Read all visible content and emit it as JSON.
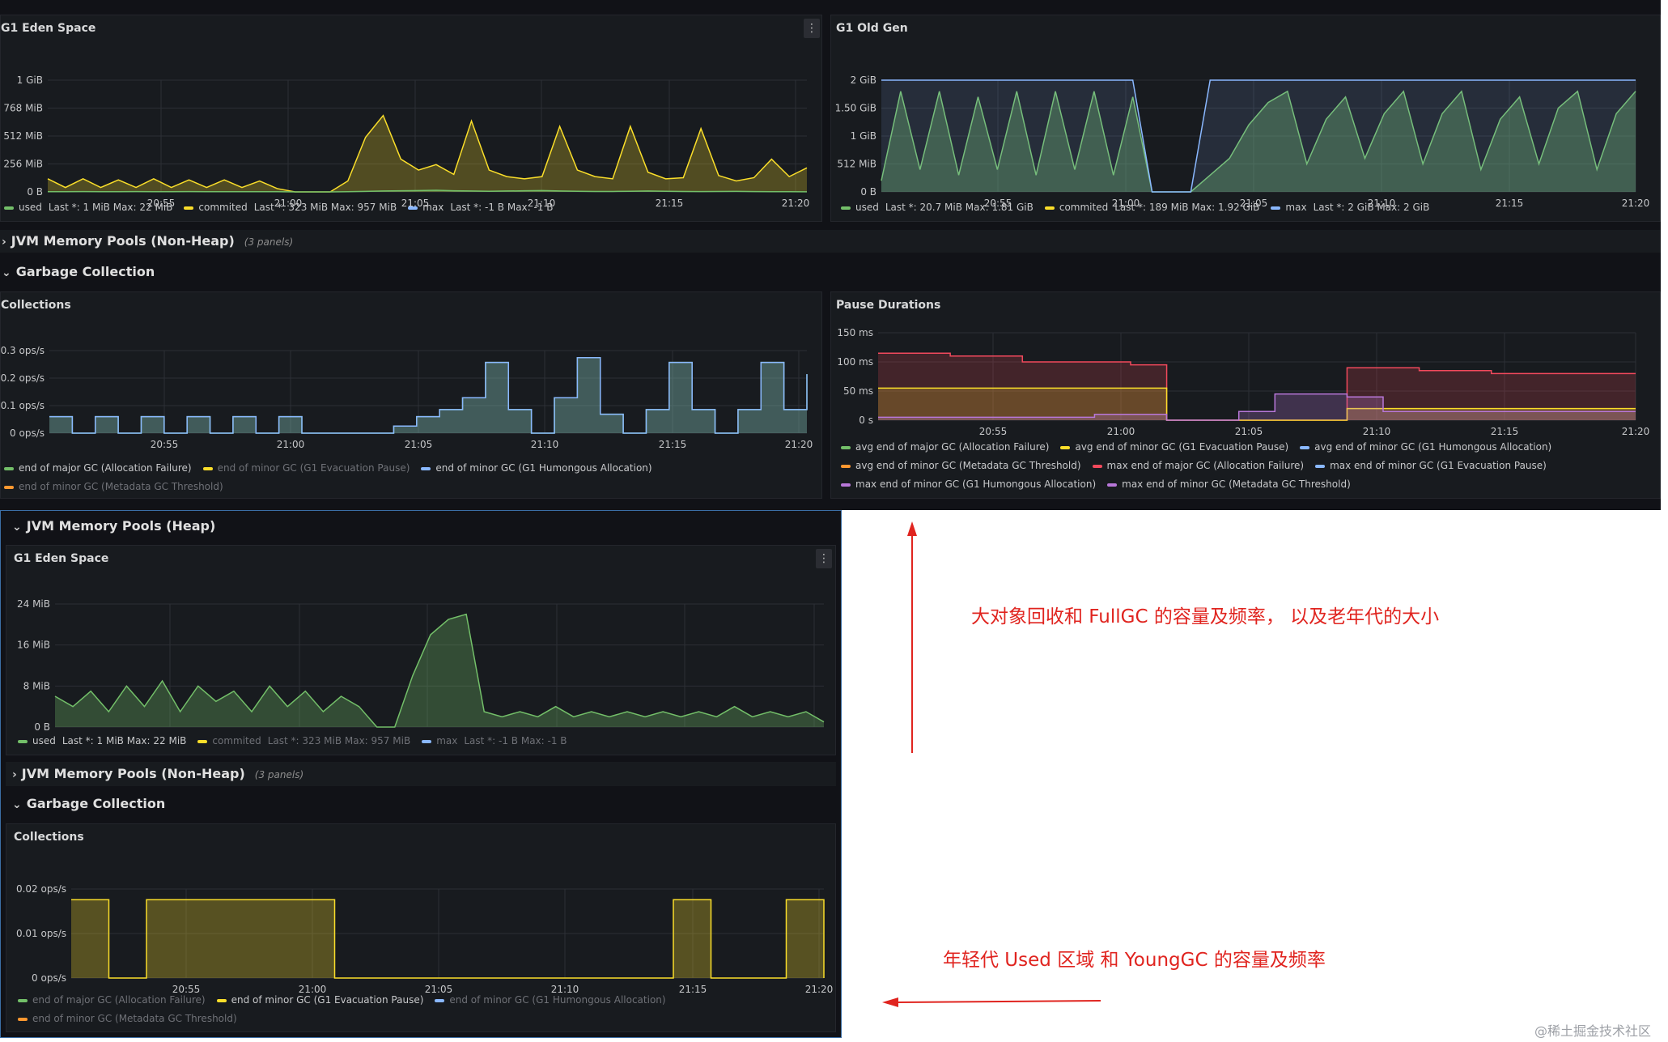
{
  "rows": {
    "non_heap": "JVM Memory Pools (Non-Heap)",
    "non_heap_count": "(3 panels)",
    "gc": "Garbage Collection",
    "heap": "JVM Memory Pools (Heap)"
  },
  "colors": {
    "green": "#73bf69",
    "yellow": "#fade2a",
    "blue": "#8ab8ff",
    "orange": "#ff9830",
    "red": "#f2495c",
    "purple": "#b877d9",
    "annotation": "#e0241f"
  },
  "panels": {
    "eden_top": {
      "title": "G1 Eden Space",
      "y_ticks": [
        "1 GiB",
        "768 MiB",
        "512 MiB",
        "256 MiB",
        "0 B"
      ],
      "x_ticks": [
        "20:55",
        "21:00",
        "21:05",
        "21:10",
        "21:15",
        "21:20"
      ],
      "legend": [
        {
          "name": "used",
          "stats": "Last *: 1 MiB  Max: 22 MiB",
          "color": "green"
        },
        {
          "name": "commited",
          "stats": "Last *: 323 MiB  Max: 957 MiB",
          "color": "yellow"
        },
        {
          "name": "max",
          "stats": "Last *: -1 B  Max: -1 B",
          "color": "blue"
        }
      ]
    },
    "old_gen": {
      "title": "G1 Old Gen",
      "y_ticks": [
        "2 GiB",
        "1.50 GiB",
        "1 GiB",
        "512 MiB",
        "0 B"
      ],
      "x_ticks": [
        "20:55",
        "21:00",
        "21:05",
        "21:10",
        "21:15",
        "21:20"
      ],
      "legend": [
        {
          "name": "used",
          "stats": "Last *: 20.7 MiB  Max: 1.81 GiB",
          "color": "green"
        },
        {
          "name": "commited",
          "stats": "Last *: 189 MiB  Max: 1.92 GiB",
          "color": "yellow"
        },
        {
          "name": "max",
          "stats": "Last *: 2 GiB  Max: 2 GiB",
          "color": "blue"
        }
      ]
    },
    "collections_top": {
      "title": "Collections",
      "y_ticks": [
        "0.3 ops/s",
        "0.2 ops/s",
        "0.1 ops/s",
        "0 ops/s"
      ],
      "x_ticks": [
        "20:55",
        "21:00",
        "21:05",
        "21:10",
        "21:15",
        "21:20"
      ],
      "legend_rows": [
        [
          {
            "name": "end of major GC (Allocation Failure)",
            "color": "green",
            "dim": false
          },
          {
            "name": "end of minor GC (G1 Evacuation Pause)",
            "color": "yellow",
            "dim": true
          },
          {
            "name": "end of minor GC (G1 Humongous Allocation)",
            "color": "blue",
            "dim": false
          }
        ],
        [
          {
            "name": "end of minor GC (Metadata GC Threshold)",
            "color": "orange",
            "dim": true
          }
        ]
      ]
    },
    "pause": {
      "title": "Pause Durations",
      "y_ticks": [
        "150 ms",
        "100 ms",
        "50 ms",
        "0 s"
      ],
      "x_ticks": [
        "20:55",
        "21:00",
        "21:05",
        "21:10",
        "21:15",
        "21:20"
      ],
      "legend_rows": [
        [
          {
            "name": "avg end of major GC (Allocation Failure)",
            "color": "green"
          },
          {
            "name": "avg end of minor GC (G1 Evacuation Pause)",
            "color": "yellow"
          },
          {
            "name": "avg end of minor GC (G1 Humongous Allocation)",
            "color": "blue"
          }
        ],
        [
          {
            "name": "avg end of minor GC (Metadata GC Threshold)",
            "color": "orange"
          },
          {
            "name": "max end of major GC (Allocation Failure)",
            "color": "red"
          },
          {
            "name": "max end of minor GC (G1 Evacuation Pause)",
            "color": "blue"
          }
        ],
        [
          {
            "name": "max end of minor GC (G1 Humongous Allocation)",
            "color": "purple"
          },
          {
            "name": "max end of minor GC (Metadata GC Threshold)",
            "color": "purple"
          }
        ]
      ]
    },
    "eden_bottom": {
      "title": "G1 Eden Space",
      "y_ticks": [
        "24 MiB",
        "16 MiB",
        "8 MiB",
        "0 B"
      ],
      "x_ticks": [
        "20:55",
        "21:00",
        "21:05",
        "21:10",
        "21:15",
        "21:20"
      ],
      "legend": [
        {
          "name": "used",
          "stats": "Last *: 1 MiB  Max: 22 MiB",
          "color": "green",
          "dim": false
        },
        {
          "name": "commited",
          "stats": "Last *: 323 MiB  Max: 957 MiB",
          "color": "yellow",
          "dim": true
        },
        {
          "name": "max",
          "stats": "Last *: -1 B  Max: -1 B",
          "color": "blue",
          "dim": true
        }
      ]
    },
    "collections_bottom": {
      "title": "Collections",
      "y_ticks": [
        "0.02 ops/s",
        "0.01 ops/s",
        "0 ops/s"
      ],
      "x_ticks": [
        "20:55",
        "21:00",
        "21:05",
        "21:10",
        "21:15",
        "21:20"
      ],
      "legend_rows": [
        [
          {
            "name": "end of major GC (Allocation Failure)",
            "color": "green",
            "dim": true
          },
          {
            "name": "end of minor GC (G1 Evacuation Pause)",
            "color": "yellow",
            "dim": false
          },
          {
            "name": "end of minor GC (G1 Humongous Allocation)",
            "color": "blue",
            "dim": true
          }
        ],
        [
          {
            "name": "end of minor GC (Metadata GC Threshold)",
            "color": "orange",
            "dim": true
          }
        ]
      ]
    }
  },
  "chart_data": [
    {
      "type": "area",
      "title": "G1 Eden Space",
      "unit": "MiB",
      "ylim": [
        0,
        1024
      ],
      "series": [
        {
          "name": "commited",
          "values": [
            120,
            40,
            120,
            40,
            110,
            40,
            120,
            40,
            110,
            40,
            110,
            40,
            100,
            30,
            0,
            0,
            0,
            100,
            500,
            700,
            300,
            200,
            250,
            160,
            650,
            200,
            140,
            120,
            140,
            600,
            200,
            140,
            120,
            600,
            180,
            120,
            130,
            580,
            150,
            100,
            130,
            300,
            140,
            220
          ]
        },
        {
          "name": "used",
          "values": [
            2,
            2,
            3,
            2,
            2,
            3,
            2,
            2,
            3,
            2,
            2,
            2,
            2,
            2,
            0,
            0,
            0,
            2,
            5,
            8,
            10,
            12,
            15,
            10,
            8,
            6,
            8,
            10,
            12,
            8,
            6,
            4,
            4,
            6,
            8,
            6,
            4,
            3,
            4,
            5,
            3,
            2,
            2,
            1
          ]
        }
      ],
      "x_ticks": [
        "20:55",
        "21:00",
        "21:05",
        "21:10",
        "21:15",
        "21:20"
      ]
    },
    {
      "type": "area",
      "title": "G1 Old Gen",
      "unit": "GiB",
      "ylim": [
        0,
        2
      ],
      "series": [
        {
          "name": "used",
          "values": [
            0.2,
            1.8,
            0.4,
            1.8,
            0.3,
            1.7,
            0.4,
            1.8,
            0.3,
            1.8,
            0.4,
            1.8,
            0.3,
            1.7,
            0,
            0,
            0,
            0.3,
            0.6,
            1.2,
            1.6,
            1.8,
            0.5,
            1.3,
            1.7,
            0.6,
            1.4,
            1.8,
            0.5,
            1.4,
            1.8,
            0.4,
            1.3,
            1.7,
            0.5,
            1.5,
            1.8,
            0.4,
            1.4,
            1.8
          ]
        },
        {
          "name": "max",
          "values": [
            2,
            2,
            2,
            2,
            2,
            2,
            2,
            2,
            2,
            2,
            2,
            2,
            2,
            2,
            0,
            0,
            0,
            2,
            2,
            2,
            2,
            2,
            2,
            2,
            2,
            2,
            2,
            2,
            2,
            2,
            2,
            2,
            2,
            2,
            2,
            2,
            2,
            2,
            2,
            2
          ]
        }
      ],
      "x_ticks": [
        "20:55",
        "21:00",
        "21:05",
        "21:10",
        "21:15",
        "21:20"
      ]
    },
    {
      "type": "area",
      "title": "Collections",
      "unit": "ops/s",
      "ylim": [
        0,
        0.35
      ],
      "series": [
        {
          "name": "end of major GC (Allocation Failure)",
          "values": [
            0.07,
            0,
            0.07,
            0,
            0.07,
            0,
            0.07,
            0,
            0.07,
            0,
            0.07,
            0,
            0,
            0,
            0,
            0.03,
            0.07,
            0.1,
            0.15,
            0.3,
            0.1,
            0,
            0.15,
            0.32,
            0.08,
            0,
            0.1,
            0.3,
            0.1,
            0,
            0.1,
            0.3,
            0.1,
            0.25
          ]
        },
        {
          "name": "end of minor GC (G1 Humongous Allocation)",
          "values": [
            0.07,
            0,
            0.07,
            0,
            0.07,
            0,
            0.07,
            0,
            0.07,
            0,
            0.07,
            0,
            0,
            0,
            0,
            0.03,
            0.07,
            0.1,
            0.15,
            0.3,
            0.1,
            0,
            0.15,
            0.32,
            0.08,
            0,
            0.1,
            0.3,
            0.1,
            0,
            0.1,
            0.3,
            0.1,
            0.25
          ]
        }
      ],
      "x_ticks": [
        "20:55",
        "21:00",
        "21:05",
        "21:10",
        "21:15",
        "21:20"
      ]
    },
    {
      "type": "area",
      "title": "Pause Durations",
      "unit": "ms",
      "ylim": [
        0,
        150
      ],
      "series": [
        {
          "name": "max end of major GC (Allocation Failure)",
          "values": [
            115,
            115,
            110,
            110,
            100,
            100,
            100,
            95,
            0,
            0,
            0,
            0,
            0,
            90,
            90,
            85,
            85,
            80,
            80,
            80,
            80,
            80
          ]
        },
        {
          "name": "avg end of major GC (Allocation Failure)",
          "values": [
            55,
            55,
            55,
            55,
            55,
            55,
            55,
            55,
            0,
            0,
            0,
            0,
            0,
            20,
            20,
            20,
            20,
            20,
            20,
            20,
            20,
            20
          ]
        },
        {
          "name": "max end of minor GC (G1 Humongous Allocation)",
          "values": [
            5,
            5,
            5,
            5,
            5,
            5,
            10,
            10,
            0,
            0,
            15,
            45,
            45,
            40,
            15,
            15,
            15,
            15,
            15,
            15,
            15,
            15
          ]
        }
      ],
      "x_ticks": [
        "20:55",
        "21:00",
        "21:05",
        "21:10",
        "21:15",
        "21:20"
      ]
    },
    {
      "type": "area",
      "title": "G1 Eden Space",
      "unit": "MiB",
      "ylim": [
        0,
        24
      ],
      "series": [
        {
          "name": "used",
          "values": [
            6,
            4,
            7,
            3,
            8,
            4,
            9,
            3,
            8,
            5,
            7,
            3,
            8,
            4,
            7,
            3,
            6,
            4,
            0,
            0,
            10,
            18,
            21,
            22,
            3,
            2,
            3,
            2,
            4,
            2,
            3,
            2,
            3,
            2,
            3,
            2,
            3,
            2,
            4,
            2,
            3,
            2,
            3,
            1
          ]
        }
      ],
      "x_ticks": [
        "20:55",
        "21:00",
        "21:05",
        "21:10",
        "21:15",
        "21:20"
      ]
    },
    {
      "type": "area",
      "title": "Collections",
      "unit": "ops/s",
      "ylim": [
        0,
        0.025
      ],
      "series": [
        {
          "name": "end of minor GC (G1 Evacuation Pause)",
          "values": [
            0.022,
            0,
            0.022,
            0.022,
            0.022,
            0.022,
            0.022,
            0,
            0,
            0,
            0,
            0,
            0,
            0,
            0,
            0,
            0.022,
            0,
            0,
            0.022,
            0
          ]
        }
      ],
      "x_ticks": [
        "20:55",
        "21:00",
        "21:05",
        "21:10",
        "21:15",
        "21:20"
      ]
    }
  ],
  "annotations": {
    "old_gen_note": "大对象回收和 FullGC 的容量及频率， 以及老年代的大小",
    "young_note": "年轻代 Used 区域 和 YoungGC  的容量及频率"
  },
  "watermark": "@稀土掘金技术社区"
}
